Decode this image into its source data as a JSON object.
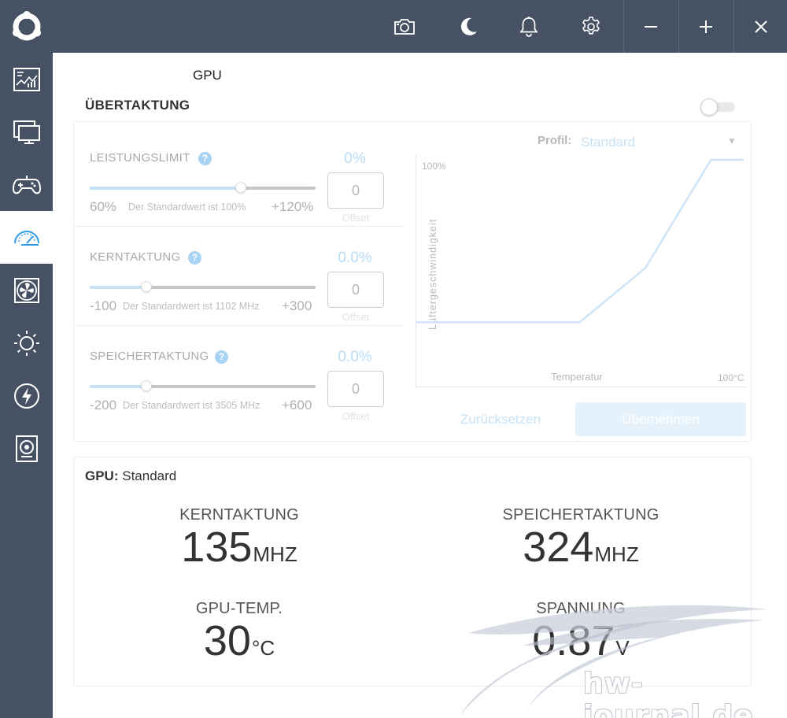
{
  "colors": {
    "chrome": "#465263",
    "accent_light": "#c4e1f6",
    "help_badge": "#a8d3f3"
  },
  "toolbar": {
    "icons": [
      "logo-icon",
      "camera-icon",
      "moon-icon",
      "bell-icon",
      "gear-icon",
      "minimize-icon",
      "maximize-icon",
      "close-icon"
    ],
    "minimize_label": "−",
    "maximize_label": "+",
    "close_label": "✕"
  },
  "sidebar": {
    "items": [
      {
        "icon": "monitoring-icon",
        "active": false
      },
      {
        "icon": "display-icon",
        "active": false
      },
      {
        "icon": "gamepad-icon",
        "active": false
      },
      {
        "icon": "speedometer-icon",
        "active": true
      },
      {
        "icon": "fan-icon",
        "active": false
      },
      {
        "icon": "brightness-icon",
        "active": false
      },
      {
        "icon": "lightning-icon",
        "active": false
      },
      {
        "icon": "speaker-icon",
        "active": false
      }
    ]
  },
  "page": {
    "device_title": "GPU",
    "section_title": "ÜBERTAKTUNG",
    "toggle_on": false
  },
  "overclock": {
    "rows": [
      {
        "label": "LEISTUNGSLIMIT",
        "help": "?",
        "percent": "0%",
        "min": "60%",
        "default_text": "Der Standardwert ist 100%",
        "max": "+120%",
        "slider_position": 0.67,
        "offset_value": "0",
        "offset_label": "Offset"
      },
      {
        "label": "KERNTAKTUNG",
        "help": "?",
        "percent": "0.0%",
        "min": "-100",
        "default_text": "Der Standardwert ist 1102 MHz",
        "max": "+300",
        "slider_position": 0.25,
        "offset_value": "0",
        "offset_label": "Offset"
      },
      {
        "label": "SPEICHERTAKTUNG",
        "help": "?",
        "percent": "0.0%",
        "min": "-200",
        "default_text": "Der Standardwert ist 3505 MHz",
        "max": "+600",
        "slider_position": 0.25,
        "offset_value": "0",
        "offset_label": "Offset"
      }
    ]
  },
  "fan_profile": {
    "label": "Profil:",
    "value": "Standard",
    "dropdown_arrow": "▼",
    "reset_label": "Zurücksetzen",
    "apply_label": "Übernehmen"
  },
  "chart_data": {
    "type": "line",
    "title": "",
    "xlabel": "Temperatur",
    "ylabel": "Lüftergeschwindigkeit",
    "x_max_label": "100°C",
    "y_max_label": "100%",
    "xlim": [
      0,
      100
    ],
    "ylim": [
      0,
      100
    ],
    "grid": false,
    "series": [
      {
        "x": [
          0,
          50,
          70,
          90,
          100
        ],
        "y": [
          40,
          40,
          60,
          100,
          100
        ]
      }
    ]
  },
  "status": {
    "gpu_label": "GPU:",
    "gpu_profile": "Standard",
    "stats": [
      {
        "label": "KERNTAKTUNG",
        "value": "135",
        "unit": "MHZ"
      },
      {
        "label": "SPEICHERTAKTUNG",
        "value": "324",
        "unit": "MHZ"
      },
      {
        "label": "GPU-TEMP.",
        "value": "30",
        "unit": "°C"
      },
      {
        "label": "SPANNUNG",
        "value": "0.87",
        "unit": "V"
      }
    ]
  },
  "watermark": {
    "text": "hw-journal.de"
  }
}
